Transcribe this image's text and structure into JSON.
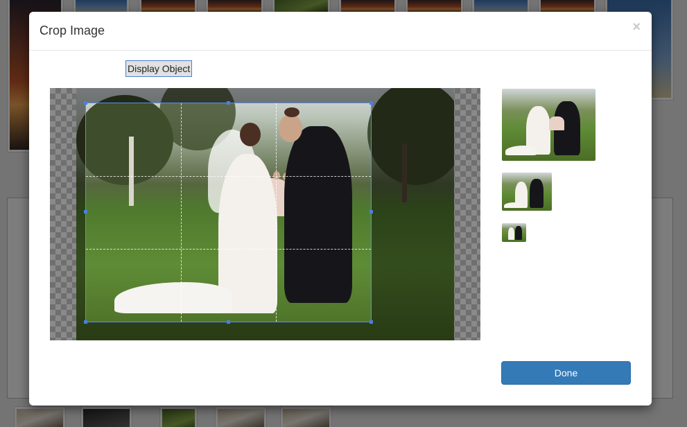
{
  "modal": {
    "title": "Crop Image",
    "close_label": "×"
  },
  "toolbar": {
    "display_object_label": "Display Object"
  },
  "footer": {
    "done_label": "Done"
  },
  "colors": {
    "primary_button": "#337ab7",
    "crop_border": "#5a8ef0",
    "overlay": "rgba(0,0,0,0.5)"
  },
  "icons": {
    "close": "close-icon"
  }
}
